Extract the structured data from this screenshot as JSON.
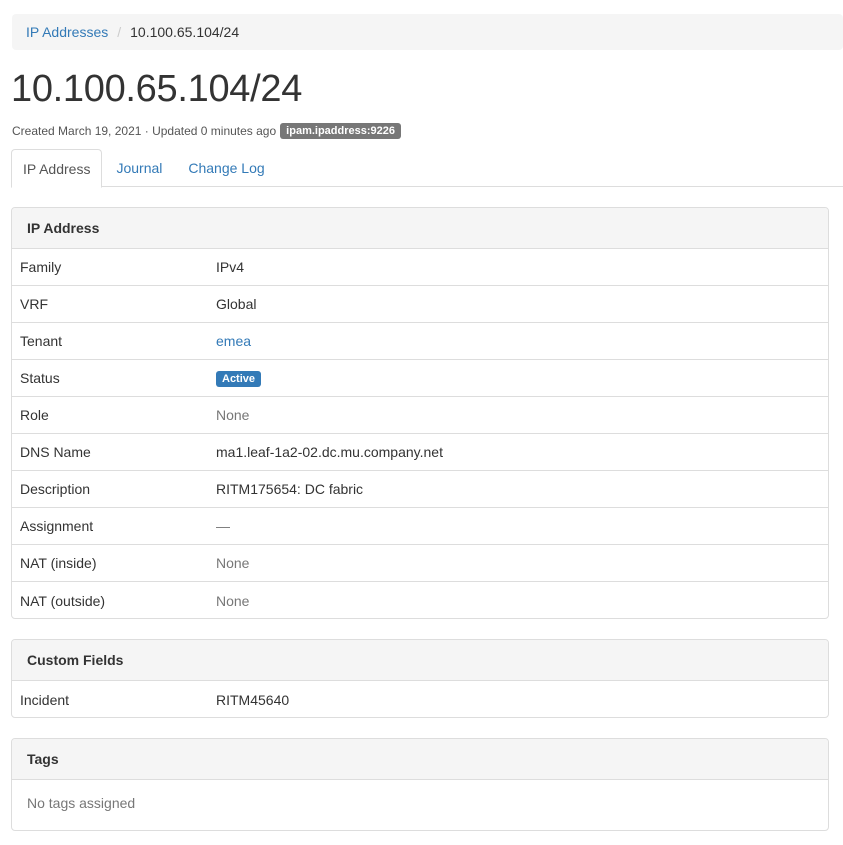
{
  "breadcrumb": {
    "parent": "IP Addresses",
    "separator": "/",
    "current": "10.100.65.104/24"
  },
  "page_title": "10.100.65.104/24",
  "meta": {
    "text": "Created March 19, 2021 · Updated 0 minutes ago",
    "object_badge": "ipam.ipaddress:9226"
  },
  "tabs": [
    {
      "label": "IP Address",
      "active": true
    },
    {
      "label": "Journal",
      "active": false
    },
    {
      "label": "Change Log",
      "active": false
    }
  ],
  "ip_panel": {
    "heading": "IP Address",
    "rows": [
      {
        "label": "Family",
        "value": "IPv4"
      },
      {
        "label": "VRF",
        "value": "Global"
      },
      {
        "label": "Tenant",
        "value": "emea"
      },
      {
        "label": "Status",
        "value": "Active"
      },
      {
        "label": "Role",
        "value": "None"
      },
      {
        "label": "DNS Name",
        "value": "ma1.leaf-1a2-02.dc.mu.company.net"
      },
      {
        "label": "Description",
        "value": "RITM175654: DC fabric"
      },
      {
        "label": "Assignment",
        "value": "—"
      },
      {
        "label": "NAT (inside)",
        "value": "None"
      },
      {
        "label": "NAT (outside)",
        "value": "None"
      }
    ]
  },
  "custom_fields_panel": {
    "heading": "Custom Fields",
    "rows": [
      {
        "label": "Incident",
        "value": "RITM45640"
      }
    ]
  },
  "tags_panel": {
    "heading": "Tags",
    "empty_text": "No tags assigned"
  },
  "colors": {
    "link": "#337ab7",
    "status_active": "#337ab7",
    "badge_gray": "#777777"
  }
}
